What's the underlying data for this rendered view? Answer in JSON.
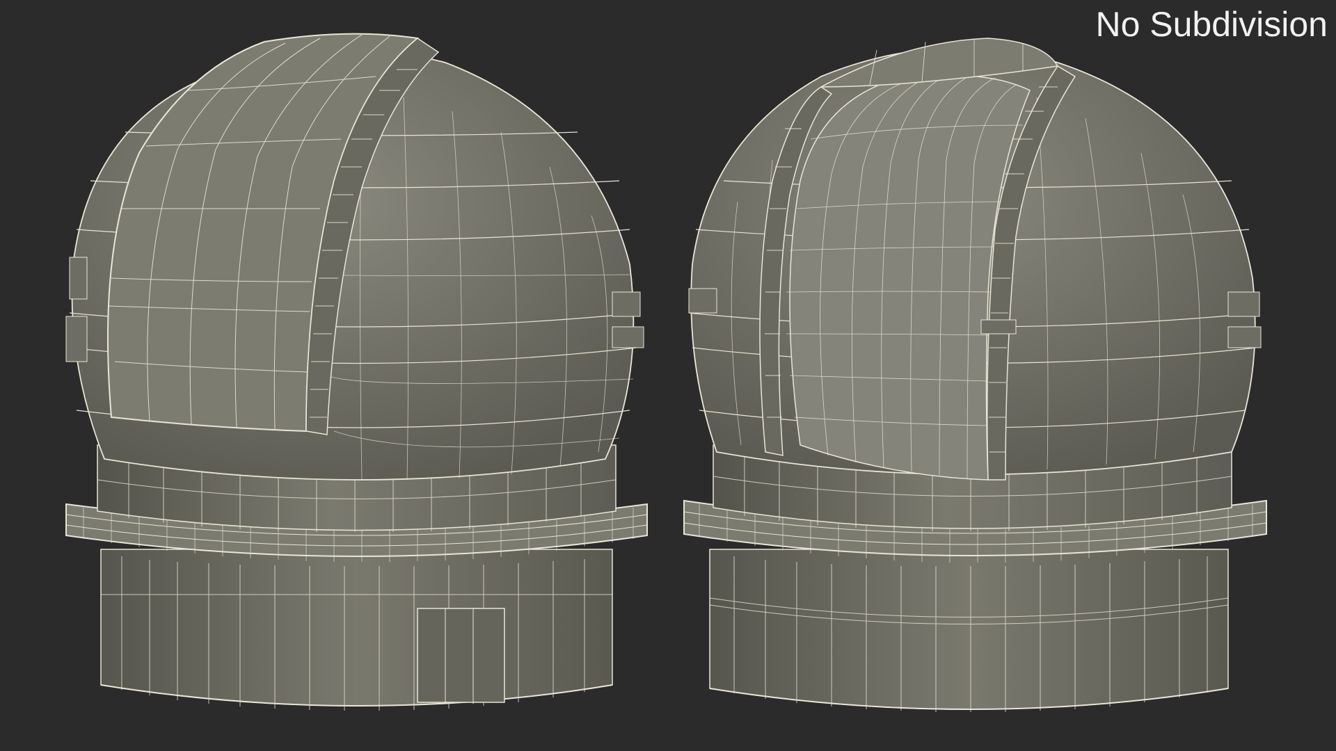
{
  "viewport": {
    "background": "#2b2b2b",
    "label": "No Subdivision"
  },
  "model": {
    "views": [
      {
        "name": "left-view",
        "shutter": "closed"
      },
      {
        "name": "right-view",
        "shutter": "open"
      }
    ],
    "colors": {
      "surface": "#6e6d63",
      "surface_light": "#86857a",
      "surface_dark": "#57564e",
      "wire": "#e8e6d6"
    }
  }
}
